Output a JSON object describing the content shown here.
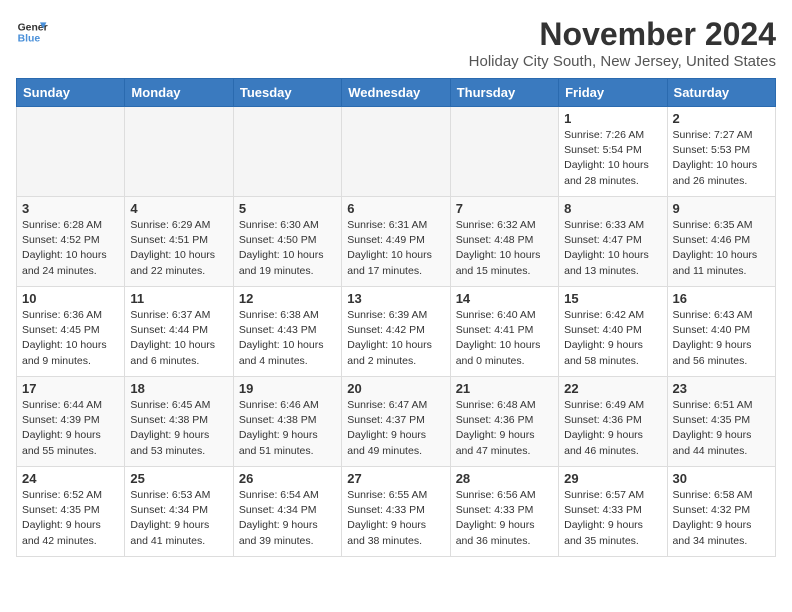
{
  "logo": {
    "line1": "General",
    "line2": "Blue"
  },
  "title": "November 2024",
  "location": "Holiday City South, New Jersey, United States",
  "weekdays": [
    "Sunday",
    "Monday",
    "Tuesday",
    "Wednesday",
    "Thursday",
    "Friday",
    "Saturday"
  ],
  "weeks": [
    [
      {
        "day": "",
        "info": ""
      },
      {
        "day": "",
        "info": ""
      },
      {
        "day": "",
        "info": ""
      },
      {
        "day": "",
        "info": ""
      },
      {
        "day": "",
        "info": ""
      },
      {
        "day": "1",
        "info": "Sunrise: 7:26 AM\nSunset: 5:54 PM\nDaylight: 10 hours\nand 28 minutes."
      },
      {
        "day": "2",
        "info": "Sunrise: 7:27 AM\nSunset: 5:53 PM\nDaylight: 10 hours\nand 26 minutes."
      }
    ],
    [
      {
        "day": "3",
        "info": "Sunrise: 6:28 AM\nSunset: 4:52 PM\nDaylight: 10 hours\nand 24 minutes."
      },
      {
        "day": "4",
        "info": "Sunrise: 6:29 AM\nSunset: 4:51 PM\nDaylight: 10 hours\nand 22 minutes."
      },
      {
        "day": "5",
        "info": "Sunrise: 6:30 AM\nSunset: 4:50 PM\nDaylight: 10 hours\nand 19 minutes."
      },
      {
        "day": "6",
        "info": "Sunrise: 6:31 AM\nSunset: 4:49 PM\nDaylight: 10 hours\nand 17 minutes."
      },
      {
        "day": "7",
        "info": "Sunrise: 6:32 AM\nSunset: 4:48 PM\nDaylight: 10 hours\nand 15 minutes."
      },
      {
        "day": "8",
        "info": "Sunrise: 6:33 AM\nSunset: 4:47 PM\nDaylight: 10 hours\nand 13 minutes."
      },
      {
        "day": "9",
        "info": "Sunrise: 6:35 AM\nSunset: 4:46 PM\nDaylight: 10 hours\nand 11 minutes."
      }
    ],
    [
      {
        "day": "10",
        "info": "Sunrise: 6:36 AM\nSunset: 4:45 PM\nDaylight: 10 hours\nand 9 minutes."
      },
      {
        "day": "11",
        "info": "Sunrise: 6:37 AM\nSunset: 4:44 PM\nDaylight: 10 hours\nand 6 minutes."
      },
      {
        "day": "12",
        "info": "Sunrise: 6:38 AM\nSunset: 4:43 PM\nDaylight: 10 hours\nand 4 minutes."
      },
      {
        "day": "13",
        "info": "Sunrise: 6:39 AM\nSunset: 4:42 PM\nDaylight: 10 hours\nand 2 minutes."
      },
      {
        "day": "14",
        "info": "Sunrise: 6:40 AM\nSunset: 4:41 PM\nDaylight: 10 hours\nand 0 minutes."
      },
      {
        "day": "15",
        "info": "Sunrise: 6:42 AM\nSunset: 4:40 PM\nDaylight: 9 hours\nand 58 minutes."
      },
      {
        "day": "16",
        "info": "Sunrise: 6:43 AM\nSunset: 4:40 PM\nDaylight: 9 hours\nand 56 minutes."
      }
    ],
    [
      {
        "day": "17",
        "info": "Sunrise: 6:44 AM\nSunset: 4:39 PM\nDaylight: 9 hours\nand 55 minutes."
      },
      {
        "day": "18",
        "info": "Sunrise: 6:45 AM\nSunset: 4:38 PM\nDaylight: 9 hours\nand 53 minutes."
      },
      {
        "day": "19",
        "info": "Sunrise: 6:46 AM\nSunset: 4:38 PM\nDaylight: 9 hours\nand 51 minutes."
      },
      {
        "day": "20",
        "info": "Sunrise: 6:47 AM\nSunset: 4:37 PM\nDaylight: 9 hours\nand 49 minutes."
      },
      {
        "day": "21",
        "info": "Sunrise: 6:48 AM\nSunset: 4:36 PM\nDaylight: 9 hours\nand 47 minutes."
      },
      {
        "day": "22",
        "info": "Sunrise: 6:49 AM\nSunset: 4:36 PM\nDaylight: 9 hours\nand 46 minutes."
      },
      {
        "day": "23",
        "info": "Sunrise: 6:51 AM\nSunset: 4:35 PM\nDaylight: 9 hours\nand 44 minutes."
      }
    ],
    [
      {
        "day": "24",
        "info": "Sunrise: 6:52 AM\nSunset: 4:35 PM\nDaylight: 9 hours\nand 42 minutes."
      },
      {
        "day": "25",
        "info": "Sunrise: 6:53 AM\nSunset: 4:34 PM\nDaylight: 9 hours\nand 41 minutes."
      },
      {
        "day": "26",
        "info": "Sunrise: 6:54 AM\nSunset: 4:34 PM\nDaylight: 9 hours\nand 39 minutes."
      },
      {
        "day": "27",
        "info": "Sunrise: 6:55 AM\nSunset: 4:33 PM\nDaylight: 9 hours\nand 38 minutes."
      },
      {
        "day": "28",
        "info": "Sunrise: 6:56 AM\nSunset: 4:33 PM\nDaylight: 9 hours\nand 36 minutes."
      },
      {
        "day": "29",
        "info": "Sunrise: 6:57 AM\nSunset: 4:33 PM\nDaylight: 9 hours\nand 35 minutes."
      },
      {
        "day": "30",
        "info": "Sunrise: 6:58 AM\nSunset: 4:32 PM\nDaylight: 9 hours\nand 34 minutes."
      }
    ]
  ]
}
